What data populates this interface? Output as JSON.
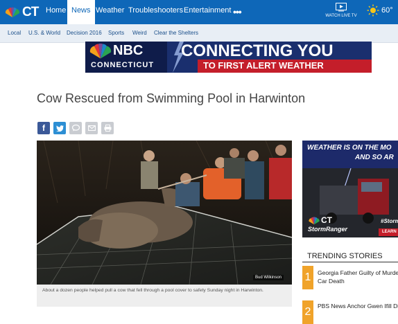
{
  "nav": {
    "logo_text": "CT",
    "items": [
      {
        "label": "Home",
        "active": false
      },
      {
        "label": "News",
        "active": true
      },
      {
        "label": "Weather",
        "active": false
      },
      {
        "label": "Troubleshooters",
        "active": false
      },
      {
        "label": "Entertainment",
        "active": false
      }
    ],
    "more": "•••",
    "watch_live": "WATCH LIVE TV",
    "temperature": "60°"
  },
  "subnav": {
    "items": [
      "Local",
      "U.S. & World",
      "Decision 2016",
      "Sports",
      "Weird",
      "Clear the Shelters"
    ]
  },
  "banner": {
    "logo": "NBC",
    "station": "CONNECTICUT",
    "line1": "CONNECTING YOU",
    "line2": "TO FIRST ALERT WEATHER"
  },
  "article": {
    "title": "Cow Rescued from Swimming Pool in Harwinton",
    "share_icons": [
      "facebook-icon",
      "twitter-icon",
      "comment-icon",
      "email-icon",
      "print-icon"
    ],
    "photo_credit": "Bud Wilkinson",
    "caption": "About a dozen people helped pull a cow that fell through a pool cover to safety Sunday night in Harwinton."
  },
  "ad": {
    "line1": "WEATHER IS ON THE MO",
    "line2": "AND SO AR",
    "brand": "CT",
    "product": "StormRanger",
    "hashtag": "#Storm",
    "cta": "LEARN"
  },
  "trending": {
    "heading": "TRENDING STORIES",
    "items": [
      {
        "num": "1",
        "text": "Georgia Father Guilty of Murde",
        "text2": "Car Death"
      },
      {
        "num": "2",
        "text": "PBS News Anchor Gwen Ifill Die",
        "text2": ""
      }
    ]
  },
  "colors": {
    "nav_blue": "#0e67b8",
    "subnav_bg": "#e8eef5",
    "banner_navy": "#1a2f6e",
    "accent_red": "#c41e2a",
    "trend_orange": "#f0a32a"
  }
}
